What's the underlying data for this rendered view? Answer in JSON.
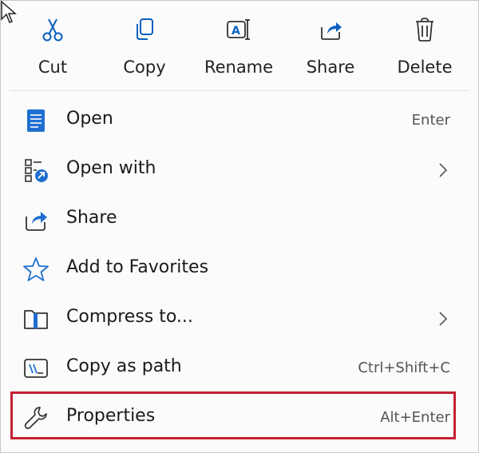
{
  "toolbar": {
    "items": [
      {
        "label": "Cut",
        "icon": "scissors-icon"
      },
      {
        "label": "Copy",
        "icon": "copy-icon"
      },
      {
        "label": "Rename",
        "icon": "rename-icon"
      },
      {
        "label": "Share",
        "icon": "share-icon"
      },
      {
        "label": "Delete",
        "icon": "trash-icon"
      }
    ]
  },
  "menu": {
    "items": [
      {
        "label": "Open",
        "shortcut": "Enter",
        "icon": "open-document-icon"
      },
      {
        "label": "Open with",
        "shortcut": "",
        "icon": "open-with-icon",
        "submenu": true
      },
      {
        "label": "Share",
        "shortcut": "",
        "icon": "share-icon"
      },
      {
        "label": "Add to Favorites",
        "shortcut": "",
        "icon": "star-icon"
      },
      {
        "label": "Compress to...",
        "shortcut": "",
        "icon": "zip-folder-icon",
        "submenu": true
      },
      {
        "label": "Copy as path",
        "shortcut": "Ctrl+Shift+C",
        "icon": "copy-path-icon"
      },
      {
        "label": "Properties",
        "shortcut": "Alt+Enter",
        "icon": "wrench-icon",
        "highlighted": true
      }
    ]
  },
  "colors": {
    "accent": "#0a5fbf",
    "highlight_border": "#c51f32"
  }
}
